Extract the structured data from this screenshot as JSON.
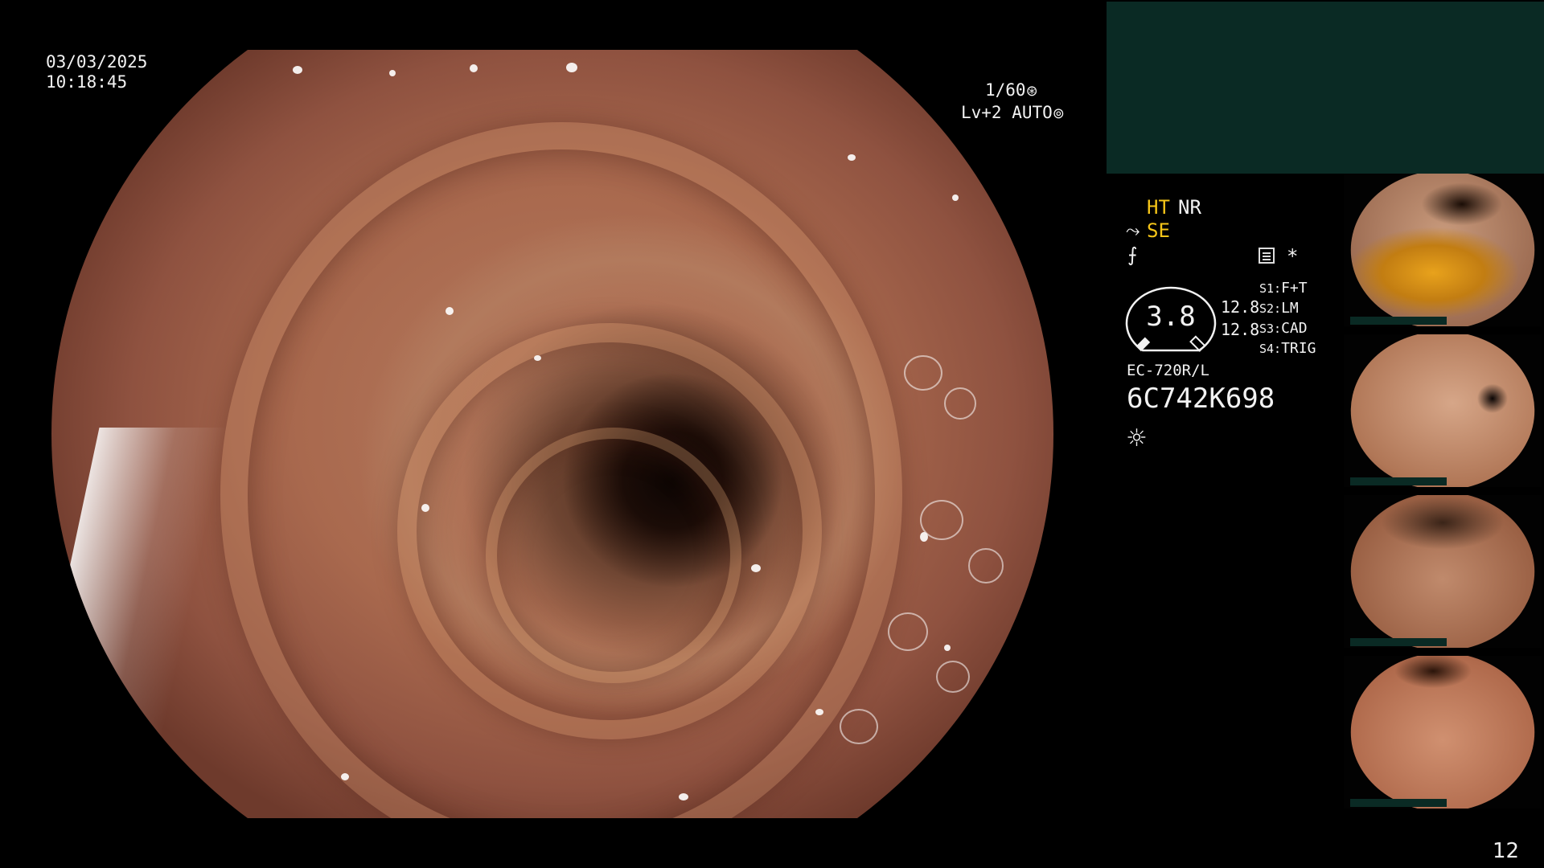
{
  "overlay": {
    "date": "03/03/2025",
    "time": "10:18:45",
    "shutter": "1/60",
    "gain": "Lv+2 AUTO"
  },
  "panel": {
    "ht": "HT",
    "nr": "NR",
    "se": "SE",
    "zoom": "3.8",
    "value_1": "12.8",
    "value_2": "12.8",
    "asterisk": "*",
    "switches": [
      {
        "key": "S1:",
        "value": "F+T"
      },
      {
        "key": "S2:",
        "value": "LM"
      },
      {
        "key": "S3:",
        "value": "CAD"
      },
      {
        "key": "S4:",
        "value": "TRIG"
      }
    ],
    "scope_model": "EC-720R/L",
    "scope_serial": "6C742K698"
  },
  "icons": {
    "shutter": "aperture-icon",
    "gain": "auto-gain-icon",
    "structure": "structure-enhancement-icon",
    "color": "color-enhancement-icon",
    "menu": "menu-icon",
    "light": "light-icon"
  },
  "colors": {
    "highlight": "#f5c518",
    "panel_teal": "#0a2a24"
  },
  "page_number": "12"
}
